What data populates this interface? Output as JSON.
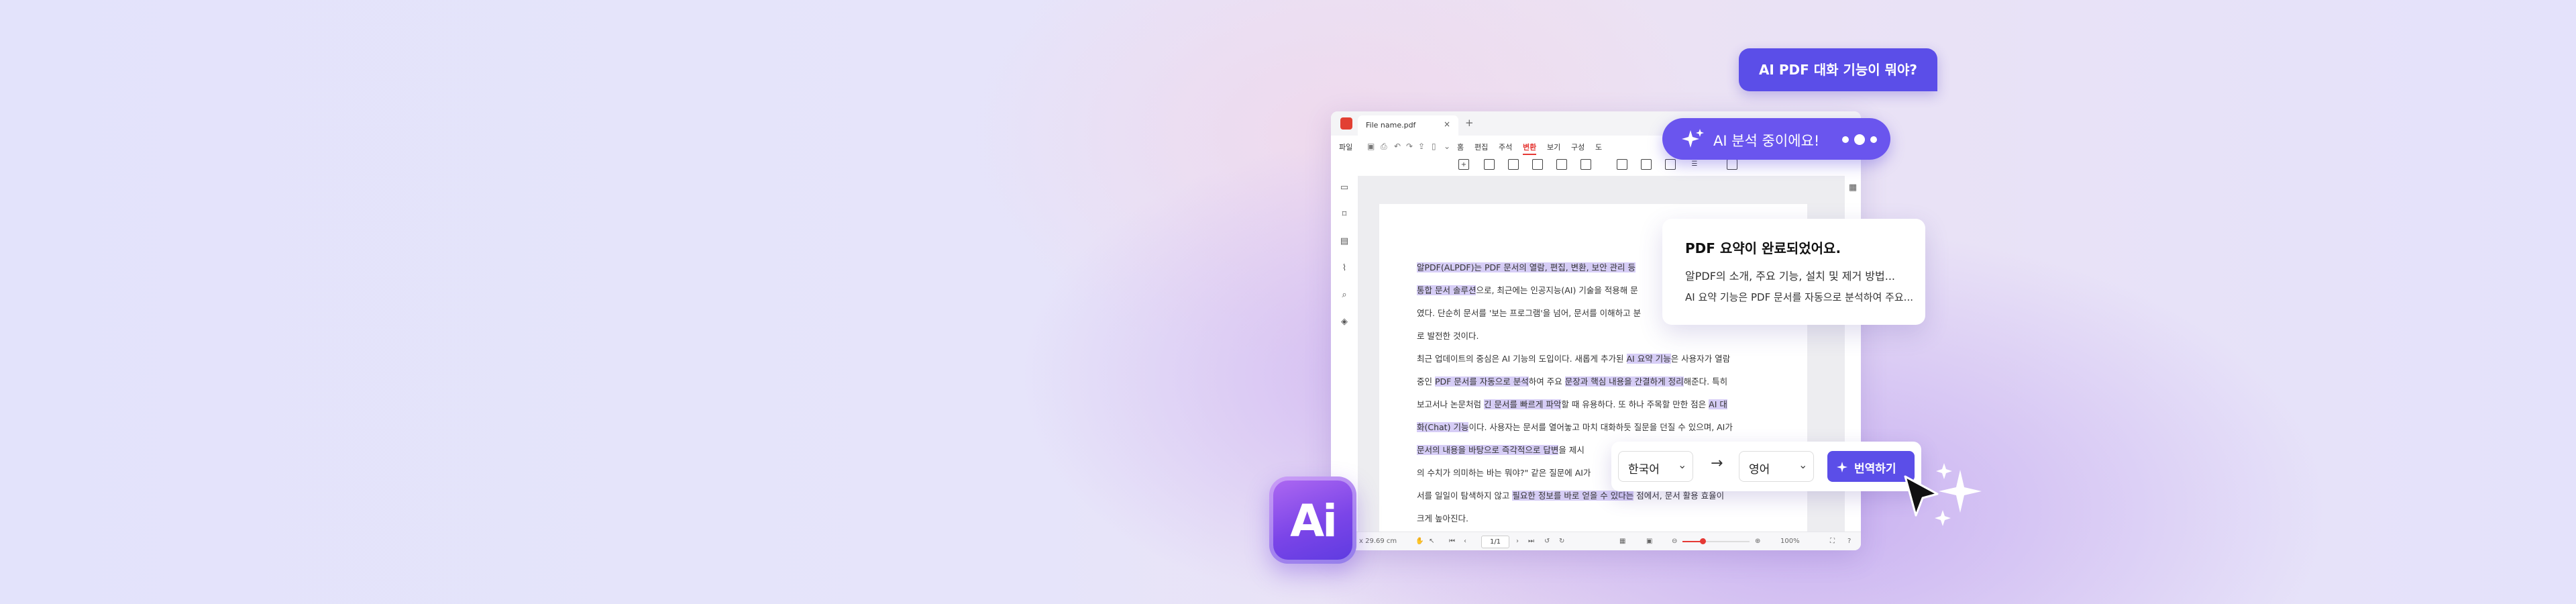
{
  "promo": {
    "question_bubble": "AI PDF 대화 기능이 뭐야?",
    "status_label": "AI 분석 중이에요!",
    "logo_text": "Ai"
  },
  "window": {
    "tab_title": "File name.pdf",
    "tab_close": "×",
    "tab_add": "+",
    "menu_left": "파일",
    "menu": [
      "홈",
      "편집",
      "주석",
      "변환",
      "보기",
      "구성",
      "도"
    ],
    "active_menu": "변환"
  },
  "document": {
    "lines": [
      [
        {
          "t": "알PDF(ALPDF)는 PDF 문서의 열람, 편집, 변환, 보안 관리 등",
          "h": true
        }
      ],
      [
        {
          "t": "통합 문서 솔루션",
          "h": true
        },
        {
          "t": "으로, 최근에는 인공지능(AI) 기술을 적용해 문",
          "h": false
        }
      ],
      [
        {
          "t": "였다. 단순히 문서를 '보는 프로그램'을 넘어, 문서를 이해하고 분",
          "h": false
        }
      ],
      [
        {
          "t": "로 발전한 것이다.",
          "h": false
        }
      ],
      [
        {
          "t": "최근 업데이트의 중심은 AI 기능의 도입이다. 새롭게 추가된 ",
          "h": false
        },
        {
          "t": "AI 요약 기능",
          "h": true
        },
        {
          "t": "은 사용자가 열람",
          "h": false
        }
      ],
      [
        {
          "t": "중인 ",
          "h": false
        },
        {
          "t": "PDF 문서를 자동으로 분석",
          "h": true
        },
        {
          "t": "하여 주요 ",
          "h": false
        },
        {
          "t": "문장과 핵심 내용을 간결하게 정리",
          "h": true
        },
        {
          "t": "해준다. 특히",
          "h": false
        }
      ],
      [
        {
          "t": "보고서나 논문처럼 ",
          "h": false
        },
        {
          "t": "긴 문서를 빠르게 파악",
          "h": true
        },
        {
          "t": "할 때 유용하다. 또 하나 주목할 만한 점은 ",
          "h": false
        },
        {
          "t": "AI 대",
          "h": true
        }
      ],
      [
        {
          "t": "화(Chat) 기능",
          "h": true
        },
        {
          "t": "이다. 사용자는 문서를 열어놓고 마치 대화하듯 질문을 던질 수 있으며, AI가",
          "h": false
        }
      ],
      [
        {
          "t": "문서의 내용을 바탕으로 즉각적으로 답변",
          "h": true
        },
        {
          "t": "을 제시",
          "h": false
        }
      ],
      [
        {
          "t": "의 수치가 의미하는 바는 뭐야?\" 같은 질문에 AI가",
          "h": false
        }
      ],
      [
        {
          "t": "서를 일일이 탐색하지 않고 ",
          "h": false
        },
        {
          "t": "필요한 정보를 바로 얻을 수 있다는",
          "h": true
        },
        {
          "t": " 점에서, 문서 활용 효율이",
          "h": false
        }
      ],
      [
        {
          "t": "크게 높아진다.",
          "h": false
        }
      ]
    ]
  },
  "statusbar": {
    "size": "x 29.69 cm",
    "page_value": "1/1",
    "zoom_value": "100%",
    "zoom_fraction": 0.3
  },
  "summary": {
    "title": "PDF 요약이 완료되었어요.",
    "line1": "알PDF의 소개, 주요 기능, 설치 및 제거 방법...",
    "line2": "AI 요약 기능은 PDF 문서를 자동으로 분석하여 주요..."
  },
  "translate": {
    "source_lang": "한국어",
    "target_lang": "영어",
    "button_label": "번역하기"
  },
  "colors": {
    "accent": "#5b4ee8",
    "highlight": "#d6cdf6",
    "app_red": "#e53935"
  }
}
